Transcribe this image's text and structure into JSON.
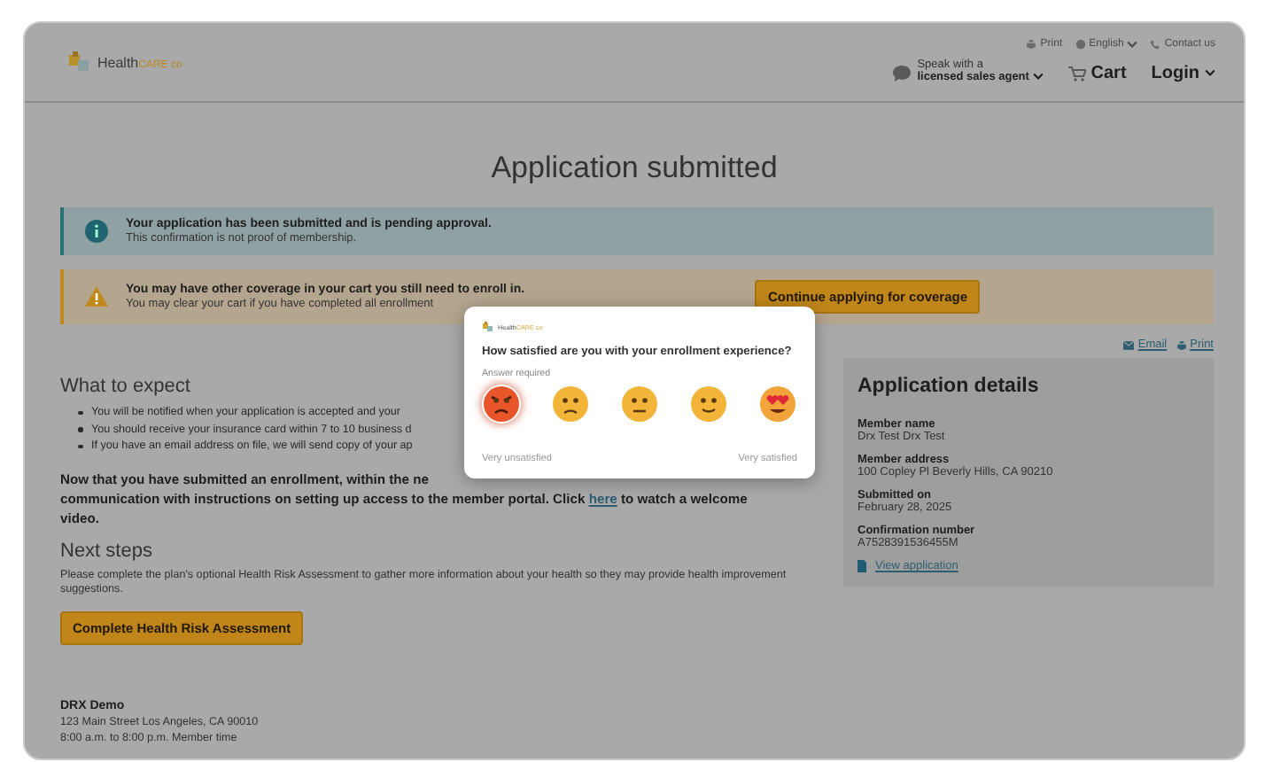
{
  "header": {
    "logo": "Health**CARE co**",
    "utility_links": [
      {
        "kind": "print",
        "label": "Print",
        "menu": false
      },
      {
        "kind": "language",
        "label": "English",
        "menu": true
      },
      {
        "kind": "contact",
        "label": "Contact us",
        "menu": false
      }
    ],
    "agent": {
      "line1": "Speak with a",
      "line2": "licensed sales agent"
    },
    "cart": "Cart",
    "login": "Login"
  },
  "title": "Application submitted",
  "alerts": [
    {
      "kind": "info",
      "title": "Your application has been submitted and is pending approval.",
      "text": "This confirmation is not proof of membership."
    },
    {
      "kind": "warning",
      "title": "You may have other coverage in your cart you still need to enroll in.",
      "text": "You may clear your cart if you have completed all enrollment",
      "action": "Continue applying for coverage"
    }
  ],
  "share_links": [
    {
      "kind": "email",
      "label": "Email"
    },
    {
      "kind": "print",
      "label": "Print"
    }
  ],
  "what_to_expect": {
    "heading": "What to expect",
    "bullets": [
      "You will be notified when your application is accepted and your",
      "You should receive your insurance card within 7 to 10 business d",
      "If you have an email address on file, we will send copy of your ap"
    ],
    "note_lines": [
      "Now that you have submitted an enrollment, within the ne",
      "communication with instructions on setting up access to the member portal. Click ",
      "here",
      " to watch a welcome",
      "video."
    ]
  },
  "next_steps": {
    "heading": "Next steps",
    "text": "Please complete the plan's optional Health Risk Assessment to gather more information about your health so they may provide health improvement suggestions.",
    "button": "Complete Health Risk Assessment"
  },
  "footer": {
    "name": "DRX Demo",
    "address": "123 Main Street Los Angeles, CA 90010",
    "hours": "8:00 a.m. to 8:00 p.m. Member time"
  },
  "details": {
    "heading": "Application details",
    "fields": [
      {
        "label": "Member name",
        "value": "Drx Test Drx Test"
      },
      {
        "label": "Member address",
        "value": "100 Copley Pl Beverly Hills, CA 90210"
      },
      {
        "label": "Submitted on",
        "value": "February 28, 2025"
      },
      {
        "label": "Confirmation number",
        "value": "A7528391536455M"
      }
    ],
    "link": "View application"
  },
  "survey": {
    "logo": "Health**CARE co**",
    "question": "How satisfied are you with your enrollment experience?",
    "required": "Answer required",
    "ratings": [
      {
        "kind": "angry",
        "selected": true
      },
      {
        "kind": "sad",
        "selected": false
      },
      {
        "kind": "neutral",
        "selected": false
      },
      {
        "kind": "smile",
        "selected": false
      },
      {
        "kind": "love",
        "selected": false
      }
    ],
    "low_label": "Very unsatisfied",
    "high_label": "Very satisfied"
  }
}
